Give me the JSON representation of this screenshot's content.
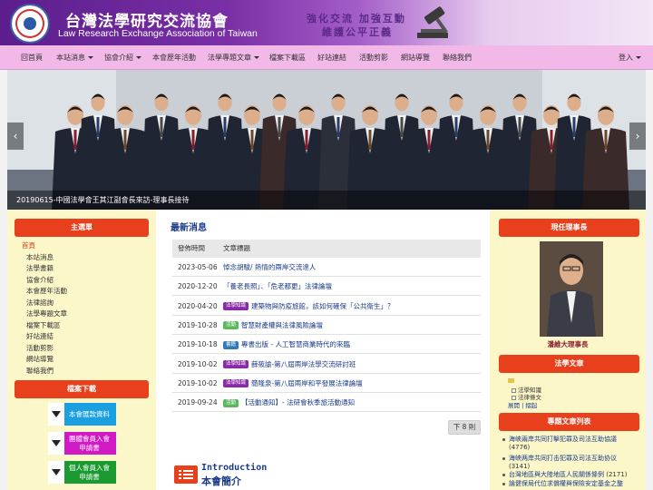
{
  "header": {
    "title": "台灣法學研究交流協會",
    "subtitle": "Law Research Exchange Association of Taiwan",
    "slogan_line1": "強化交流 加強互動",
    "slogan_line2": "維護公平正義"
  },
  "nav": {
    "items": [
      {
        "label": "回首頁",
        "dropdown": false
      },
      {
        "label": "本站消息",
        "dropdown": true
      },
      {
        "label": "協會介紹",
        "dropdown": true
      },
      {
        "label": "本會歷年活動",
        "dropdown": false
      },
      {
        "label": "法學專題文章",
        "dropdown": true
      },
      {
        "label": "檔案下載區",
        "dropdown": false
      },
      {
        "label": "好站連結",
        "dropdown": false
      },
      {
        "label": "活動剪影",
        "dropdown": false
      },
      {
        "label": "網站導覽",
        "dropdown": false
      },
      {
        "label": "聯絡我們",
        "dropdown": false
      }
    ],
    "login": "登入"
  },
  "slider": {
    "caption": "20190615-中國法學會王其江副會長來訪-理事長接待",
    "prev": "‹",
    "next": "›"
  },
  "main_menu": {
    "title": "主選單",
    "items": [
      "首頁",
      "本站消息",
      "法學書籍",
      "協會介紹",
      "本會歷年活動",
      "法律諮詢",
      "法學專題文章",
      "檔案下載區",
      "好站連結",
      "活動剪影",
      "網站導覽",
      "聯絡我們"
    ]
  },
  "downloads": {
    "title": "檔案下載",
    "buttons": [
      {
        "line1": "本會匯款資料",
        "line2": "",
        "color": "#1aa0e0"
      },
      {
        "line1": "團體會員入會",
        "line2": "申請書",
        "color": "#d11ac4"
      },
      {
        "line1": "個人會員入會",
        "line2": "申請書",
        "color": "#1a9a30"
      }
    ]
  },
  "news": {
    "title": "最新消息",
    "col_date": "發佈時間",
    "col_title": "文章標題",
    "rows": [
      {
        "date": "2023-05-06",
        "badge": "",
        "badge_color": "",
        "title": "悼念胡駿/ 熱情的兩岸交流達人"
      },
      {
        "date": "2020-12-20",
        "badge": "",
        "badge_color": "",
        "title": "「養老長照」、「危老都更」法律論壇"
      },
      {
        "date": "2020-04-20",
        "badge": "法學知識",
        "badge_color": "#8a2aa8",
        "title": "建築物與防疫旅館，該如何確保「公共衛生」？"
      },
      {
        "date": "2019-10-28",
        "badge": "活動",
        "badge_color": "#5cb85c",
        "title": "智慧財產權與法律風險論壇"
      },
      {
        "date": "2019-10-18",
        "badge": "書籍",
        "badge_color": "#337ab7",
        "title": "專書出版 - 人工智慧商業時代的來臨"
      },
      {
        "date": "2019-10-02",
        "badge": "法學知識",
        "badge_color": "#8a2aa8",
        "title": "薛筱諭-第八屆兩岸法學交流研討班"
      },
      {
        "date": "2019-10-02",
        "badge": "法學知識",
        "badge_color": "#8a2aa8",
        "title": "簡隆泉-第八屆兩岸和平發展法律論壇"
      },
      {
        "date": "2019-09-24",
        "badge": "活動",
        "badge_color": "#5cb85c",
        "title": "【活動通知】- 法研會秋季旅活動通知"
      }
    ],
    "pager": "下 8 則"
  },
  "intro": {
    "en": "Introduction",
    "zh": "本會簡介"
  },
  "chairman": {
    "title": "現任理事長",
    "name": "潘維大理事長"
  },
  "law_articles": {
    "title": "法學文章",
    "tree": [
      "法學知識",
      "法律條文"
    ],
    "links": [
      "展開",
      "摺起"
    ]
  },
  "topics": {
    "title": "專題文章列表",
    "items": [
      {
        "title": "海峽兩岸共同打擊犯罪及司法互助協議",
        "count": "(4776)"
      },
      {
        "title": "海峡两岸共同打击犯罪及司法互助协议",
        "count": "(3141)"
      },
      {
        "title": "台灣地區與大陸地區人民關係條例",
        "count": "(2171)"
      },
      {
        "title": "論健保局代位求償權與保險安定基金之整",
        "count": ""
      }
    ]
  }
}
